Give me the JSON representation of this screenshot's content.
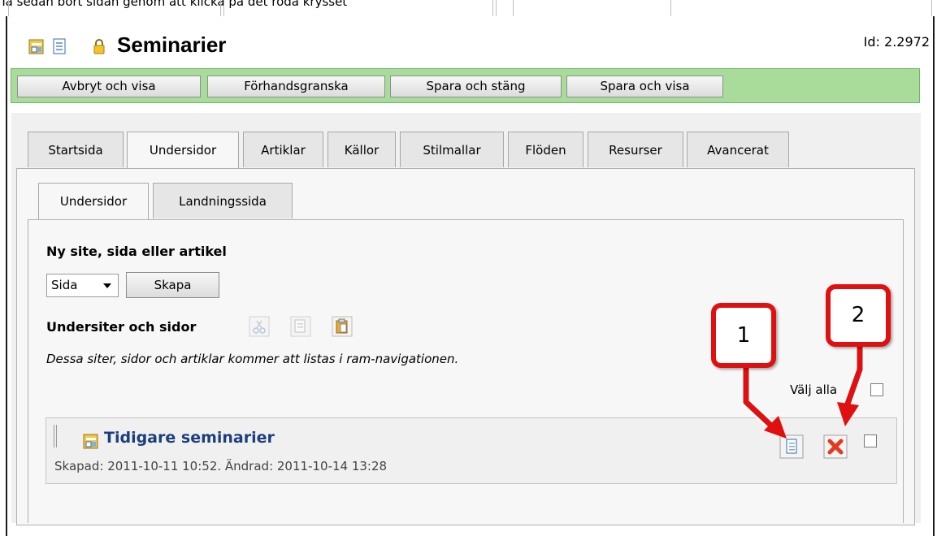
{
  "caption": "Ta sedan bort sidan genom att klicka på det röda krysset",
  "page": {
    "title": "Seminarier",
    "id_label": "Id: 2.2972"
  },
  "toolbar": {
    "cancel_label": "Avbryt och visa",
    "preview_label": "Förhandsgranska",
    "save_close_label": "Spara och stäng",
    "save_view_label": "Spara och visa"
  },
  "tabs": [
    {
      "label": "Startsida"
    },
    {
      "label": "Undersidor"
    },
    {
      "label": "Artiklar"
    },
    {
      "label": "Källor"
    },
    {
      "label": "Stilmallar"
    },
    {
      "label": "Flöden"
    },
    {
      "label": "Resurser"
    },
    {
      "label": "Avancerat"
    }
  ],
  "subtabs": [
    {
      "label": "Undersidor"
    },
    {
      "label": "Landningssida"
    }
  ],
  "create": {
    "heading": "Ny site, sida eller artikel",
    "select_value": "Sida",
    "button_label": "Skapa"
  },
  "list": {
    "heading": "Undersiter och sidor",
    "description": "Dessa siter, sidor och artiklar kommer att listas i ram-navigationen.",
    "select_all_label": "Välj alla",
    "items": [
      {
        "title": "Tidigare seminarier",
        "meta": "Skapad: 2011-10-11 10:52. Ändrad: 2011-10-14 13:28"
      }
    ]
  },
  "callouts": [
    "1",
    "2"
  ],
  "colors": {
    "toolbar_bg": "#a9dc9a",
    "callout_red": "#e01010",
    "link_blue": "#1c3f7c",
    "delete_red": "#e23b20"
  }
}
